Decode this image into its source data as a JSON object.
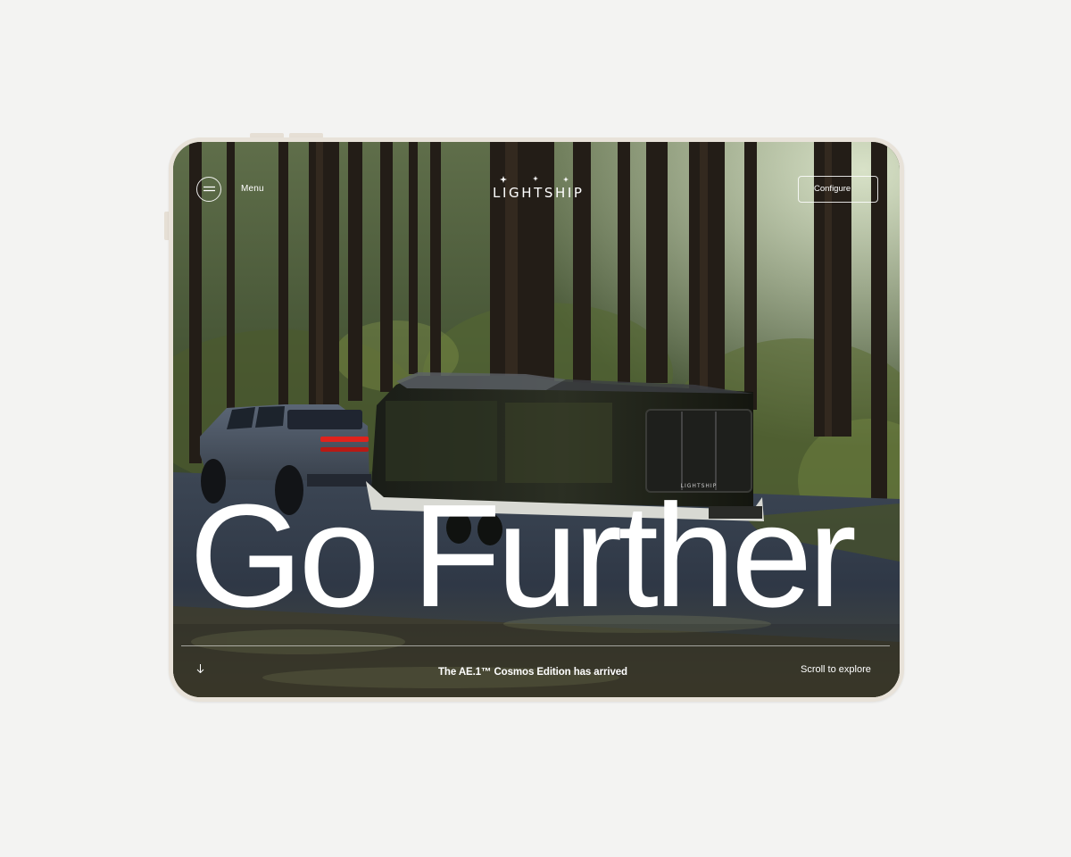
{
  "nav": {
    "menu_label": "Menu",
    "brand": "LIGHTSHIP",
    "cta_label": "Configure"
  },
  "hero": {
    "headline": "Go Further",
    "announcement": "The AE.1™ Cosmos Edition has arrived",
    "scroll_hint": "Scroll to explore"
  },
  "trailer_badge": "LIGHTSHIP",
  "colors": {
    "page_background": "#f3f3f2",
    "device_frame": "#e8e2d9",
    "text": "#ffffff",
    "taillight": "#e0221c"
  },
  "icons": {
    "menu": "hamburger-icon",
    "brand_mark": "star-sparkle-icon",
    "scroll": "arrow-down-icon"
  }
}
